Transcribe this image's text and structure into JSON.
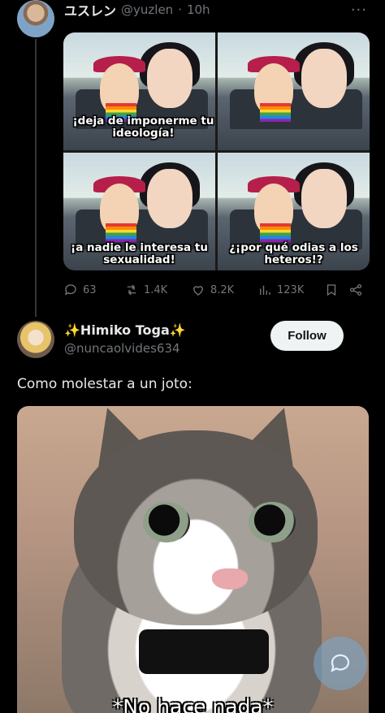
{
  "post1": {
    "author_name": "ユスレン",
    "handle": "@yuzlen",
    "separator": "·",
    "time": "10h",
    "more": "···",
    "comic_captions": [
      "¡deja de imponerme tu ideología!",
      "",
      "¡a nadie le interesa tu sexualidad!",
      "¿¡por qué odias a los heteros!?"
    ],
    "stats": {
      "replies": "63",
      "reposts": "1.4K",
      "likes": "8.2K",
      "views": "123K"
    }
  },
  "post2": {
    "author_name": "✨Himiko Toga✨",
    "handle": "@nuncaolvides634",
    "follow_label": "Follow",
    "text": "Como molestar a un joto:",
    "image_caption": "*No hace nada*"
  },
  "icons": [
    "reply-icon",
    "repost-icon",
    "like-icon",
    "views-icon",
    "bookmark-icon",
    "share-icon",
    "chat-bubble-icon"
  ],
  "colors": {
    "background": "#000000",
    "muted": "#71767b",
    "text": "#e7e9ea",
    "follow_bg": "#eff3f4"
  }
}
